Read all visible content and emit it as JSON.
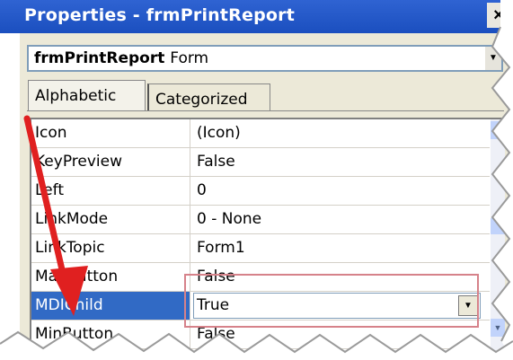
{
  "window": {
    "title": "Properties - frmPrintReport",
    "close_glyph": "×"
  },
  "object_combo": {
    "name": "frmPrintReport",
    "type": "Form"
  },
  "tabs": [
    {
      "label": "Alphabetic",
      "active": true
    },
    {
      "label": "Categorized",
      "active": false
    }
  ],
  "properties": [
    {
      "name": "Icon",
      "value": "(Icon)"
    },
    {
      "name": "KeyPreview",
      "value": "False"
    },
    {
      "name": "Left",
      "value": "0"
    },
    {
      "name": "LinkMode",
      "value": "0 - None"
    },
    {
      "name": "LinkTopic",
      "value": "Form1"
    },
    {
      "name": "MaxButton",
      "value": "False"
    },
    {
      "name": "MDIChild",
      "value": "True",
      "selected": true
    },
    {
      "name": "MinButton",
      "value": "False"
    }
  ],
  "colors": {
    "titlebar": "#1b4fbf",
    "selection": "#316ac5",
    "annotation_arrow": "#e02020",
    "highlight_box": "#d6828a"
  },
  "icons": {
    "dropdown": "chevron-down-icon",
    "scroll_up": "scroll-up-icon",
    "scroll_down": "scroll-down-icon"
  }
}
